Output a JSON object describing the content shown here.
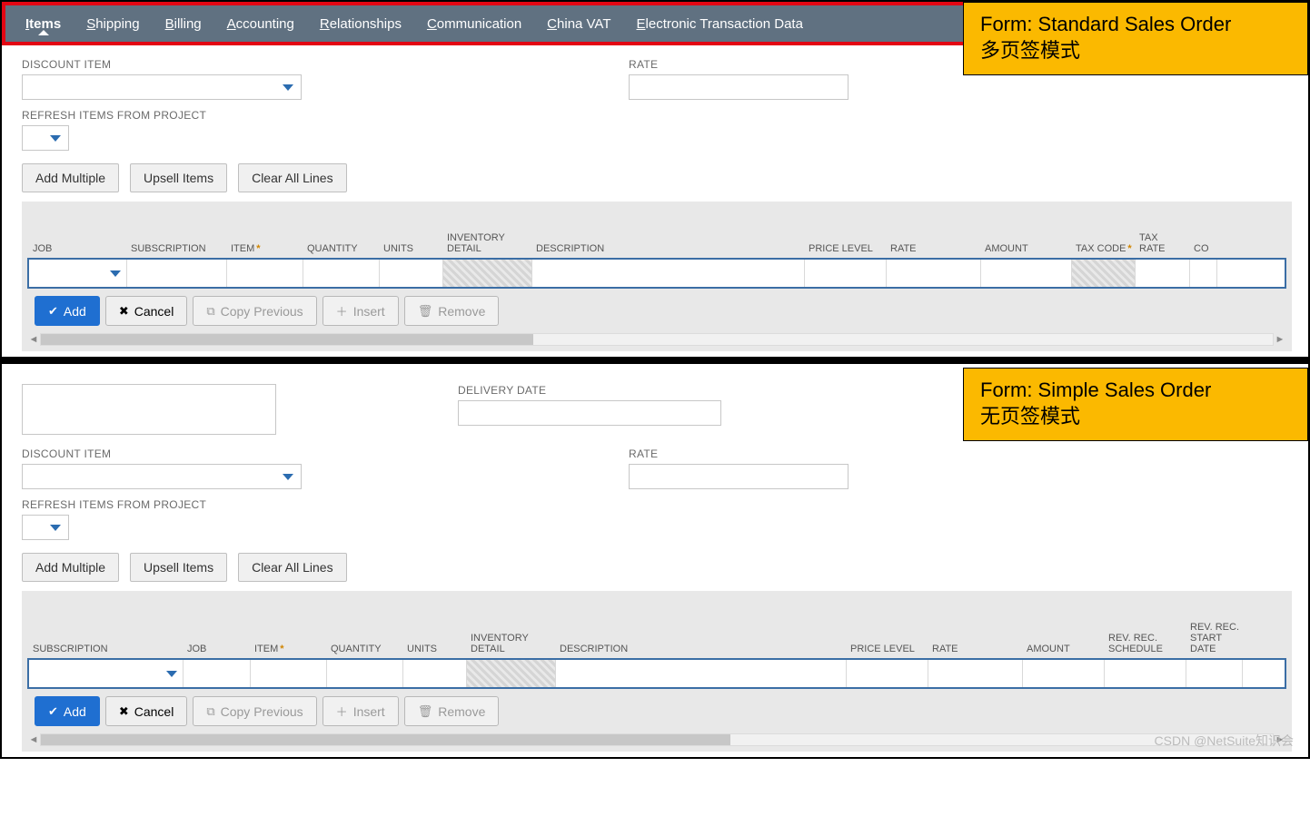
{
  "top": {
    "note_line1": "Form: Standard Sales Order",
    "note_line2": "多页签模式",
    "tabs": [
      "Items",
      "Shipping",
      "Billing",
      "Accounting",
      "Relationships",
      "Communication",
      "China VAT",
      "Electronic Transaction Data"
    ],
    "active_tab_index": 0,
    "discount_item_label": "DISCOUNT ITEM",
    "rate_label": "RATE",
    "refresh_label": "REFRESH ITEMS FROM PROJECT",
    "btn_add_multiple": "Add Multiple",
    "btn_upsell": "Upsell Items",
    "btn_clear": "Clear All Lines",
    "grid_headers": [
      "JOB",
      "SUBSCRIPTION",
      "ITEM",
      "QUANTITY",
      "UNITS",
      "INVENTORY DETAIL",
      "DESCRIPTION",
      "PRICE LEVEL",
      "RATE",
      "AMOUNT",
      "TAX CODE",
      "TAX RATE",
      "CO"
    ],
    "grid_required": {
      "ITEM": true,
      "TAX CODE": true
    },
    "grid_col_widths": [
      108,
      110,
      84,
      84,
      70,
      98,
      300,
      90,
      104,
      100,
      70,
      60,
      30
    ],
    "row_btn_add": "Add",
    "row_btn_cancel": "Cancel",
    "row_btn_copy": "Copy Previous",
    "row_btn_insert": "Insert",
    "row_btn_remove": "Remove"
  },
  "bottom": {
    "note_line1": "Form: Simple Sales Order",
    "note_line2": "无页签模式",
    "delivery_date_label": "DELIVERY DATE",
    "discount_item_label": "DISCOUNT ITEM",
    "rate_label": "RATE",
    "refresh_label": "REFRESH ITEMS FROM PROJECT",
    "btn_add_multiple": "Add Multiple",
    "btn_upsell": "Upsell Items",
    "btn_clear": "Clear All Lines",
    "grid_headers": [
      "SUBSCRIPTION",
      "JOB",
      "ITEM",
      "QUANTITY",
      "UNITS",
      "INVENTORY DETAIL",
      "DESCRIPTION",
      "PRICE LEVEL",
      "RATE",
      "AMOUNT",
      "REV. REC. SCHEDULE",
      "REV. REC. START DATE"
    ],
    "grid_required": {
      "ITEM": true
    },
    "grid_col_widths": [
      170,
      74,
      84,
      84,
      70,
      98,
      320,
      90,
      104,
      90,
      90,
      62
    ],
    "row_btn_add": "Add",
    "row_btn_cancel": "Cancel",
    "row_btn_copy": "Copy Previous",
    "row_btn_insert": "Insert",
    "row_btn_remove": "Remove"
  },
  "watermark": "CSDN @NetSuite知识会"
}
